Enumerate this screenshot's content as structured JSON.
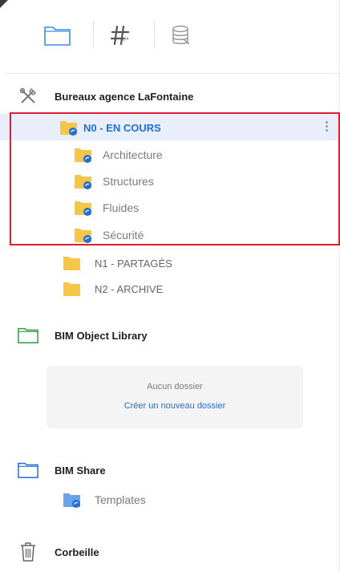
{
  "toolbar": {
    "buttons": [
      {
        "name": "folders-view-button",
        "icon": "folder-outline-icon"
      },
      {
        "name": "tags-view-button",
        "icon": "hashtag-icon"
      },
      {
        "name": "database-view-button",
        "icon": "database-icon"
      }
    ]
  },
  "project": {
    "icon": "tools-crossed-icon",
    "label": "Bureaux agence LaFontaine",
    "folders": [
      {
        "label": "N0 - EN COURS",
        "active": true,
        "shared": true
      },
      {
        "label": "Architecture",
        "shared": true
      },
      {
        "label": "Structures",
        "shared": true
      },
      {
        "label": "Fluides",
        "shared": true
      },
      {
        "label": "Sécurité",
        "shared": true
      },
      {
        "label": "N1 - PARTAGÉS",
        "shared": false
      },
      {
        "label": "N2 - ARCHIVE",
        "shared": false
      }
    ]
  },
  "library": {
    "icon": "green-folder-icon",
    "label": "BIM Object Library",
    "empty_text": "Aucun dossier",
    "create_link": "Créer un nouveau dossier"
  },
  "share": {
    "icon": "blue-folder-icon",
    "label": "BIM Share",
    "items": [
      {
        "label": "Templates"
      }
    ]
  },
  "trash": {
    "icon": "trash-icon",
    "label": "Corbeille"
  },
  "colors": {
    "accent": "#1f6fd8",
    "folder_yellow": "#f6c744",
    "folder_blue": "#4a90e2",
    "selection_border": "#e11d2f",
    "active_row_bg": "#e9effa"
  }
}
